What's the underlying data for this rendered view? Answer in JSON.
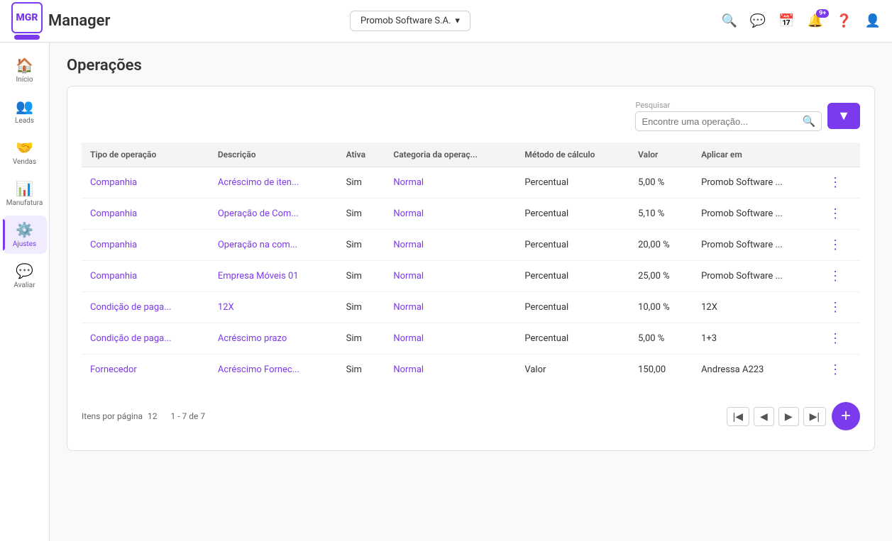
{
  "app": {
    "logo_text": "MGR",
    "name": "Manager"
  },
  "topbar": {
    "company_label": "Promob Software S.A.",
    "notification_badge": "9+",
    "icons": [
      "search",
      "chat",
      "calendar",
      "bell",
      "help",
      "user"
    ]
  },
  "sidebar": {
    "items": [
      {
        "id": "inicio",
        "label": "Início",
        "icon": "🏠",
        "active": false
      },
      {
        "id": "leads",
        "label": "Leads",
        "icon": "👥",
        "active": false
      },
      {
        "id": "vendas",
        "label": "Vendas",
        "icon": "🤝",
        "active": false
      },
      {
        "id": "manufatura",
        "label": "Manufatura",
        "icon": "📊",
        "active": false
      },
      {
        "id": "ajustes",
        "label": "Ajustes",
        "icon": "⚙️",
        "active": true
      },
      {
        "id": "avaliar",
        "label": "Avaliar",
        "icon": "💬",
        "active": false
      }
    ]
  },
  "page": {
    "title": "Operações"
  },
  "search": {
    "label": "Pesquisar",
    "placeholder": "Encontre uma operação..."
  },
  "table": {
    "columns": [
      "Tipo de operação",
      "Descrição",
      "Ativa",
      "Categoria da operaç...",
      "Método de cálculo",
      "Valor",
      "Aplicar em",
      ""
    ],
    "rows": [
      {
        "tipo": "Companhia",
        "descricao": "Acréscimo de iten...",
        "ativa": "Sim",
        "categoria": "Normal",
        "metodo": "Percentual",
        "valor": "5,00 %",
        "aplicar": "Promob Software ..."
      },
      {
        "tipo": "Companhia",
        "descricao": "Operação de Com...",
        "ativa": "Sim",
        "categoria": "Normal",
        "metodo": "Percentual",
        "valor": "5,10 %",
        "aplicar": "Promob Software ..."
      },
      {
        "tipo": "Companhia",
        "descricao": "Operação na com...",
        "ativa": "Sim",
        "categoria": "Normal",
        "metodo": "Percentual",
        "valor": "20,00 %",
        "aplicar": "Promob Software ..."
      },
      {
        "tipo": "Companhia",
        "descricao": "Empresa Móveis 01",
        "ativa": "Sim",
        "categoria": "Normal",
        "metodo": "Percentual",
        "valor": "25,00 %",
        "aplicar": "Promob Software ..."
      },
      {
        "tipo": "Condição de paga...",
        "descricao": "12X",
        "ativa": "Sim",
        "categoria": "Normal",
        "metodo": "Percentual",
        "valor": "10,00 %",
        "aplicar": "12X"
      },
      {
        "tipo": "Condição de paga...",
        "descricao": "Acréscimo prazo",
        "ativa": "Sim",
        "categoria": "Normal",
        "metodo": "Percentual",
        "valor": "5,00 %",
        "aplicar": "1+3"
      },
      {
        "tipo": "Fornecedor",
        "descricao": "Acréscimo Fornec...",
        "ativa": "Sim",
        "categoria": "Normal",
        "metodo": "Valor",
        "valor": "150,00",
        "aplicar": "Andressa A223"
      }
    ]
  },
  "pagination": {
    "items_per_page_label": "Itens por página",
    "items_per_page": "12",
    "range_label": "1 - 7 de 7"
  },
  "fab": {
    "label": "+"
  }
}
